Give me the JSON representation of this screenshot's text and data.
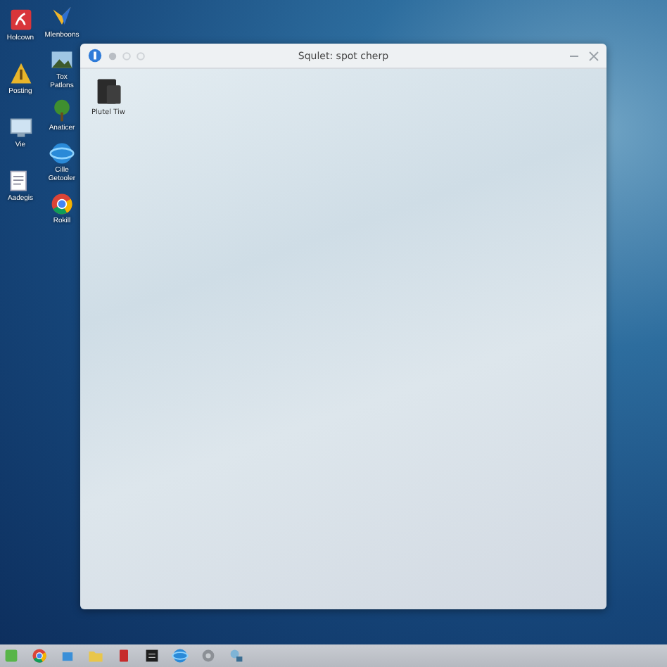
{
  "desktop_icon_columns": [
    [
      {
        "label": "Holcown",
        "kind": "red-tile"
      },
      {
        "label": "Posting",
        "kind": "scales"
      },
      {
        "label": "Vie",
        "kind": "monitor"
      },
      {
        "label": "Aadegis",
        "kind": "document"
      }
    ],
    [
      {
        "label": "Mlenboons",
        "kind": "bird"
      },
      {
        "label": "Tox Patlons",
        "kind": "photo"
      },
      {
        "label": "Anaticer",
        "kind": "tree"
      },
      {
        "label": "Cille Getooler",
        "kind": "globe"
      },
      {
        "label": "Rokill",
        "kind": "chrome"
      }
    ]
  ],
  "window": {
    "title": "Squlet: spot cherp",
    "files": [
      {
        "label": "Plutel Tiw",
        "kind": "printer"
      }
    ]
  },
  "taskbar": {
    "apps": [
      {
        "kind": "green"
      },
      {
        "kind": "chrome"
      },
      {
        "kind": "blue-folder"
      },
      {
        "kind": "folder"
      },
      {
        "kind": "red"
      },
      {
        "kind": "black"
      },
      {
        "kind": "globe"
      },
      {
        "kind": "grey-circle"
      },
      {
        "kind": "network"
      }
    ]
  }
}
